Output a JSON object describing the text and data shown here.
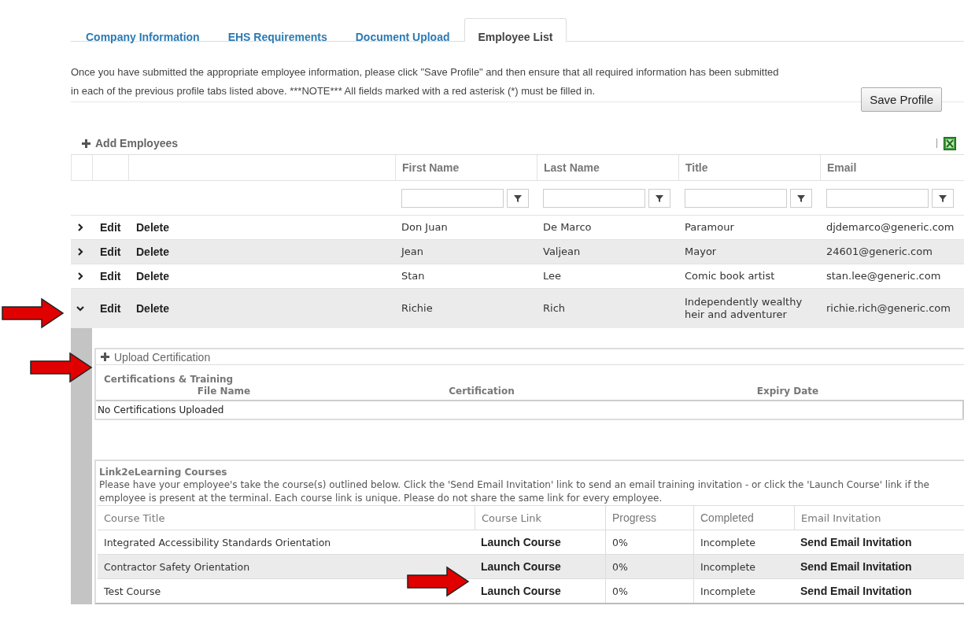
{
  "tabs": [
    {
      "label": "Company Information",
      "selected": false
    },
    {
      "label": "EHS Requirements",
      "selected": false
    },
    {
      "label": "Document Upload",
      "selected": false
    },
    {
      "label": "Employee List",
      "selected": true
    }
  ],
  "instructions": "Once you have submitted the appropriate employee information, please click \"Save Profile\" and then ensure that all required information has been submitted in each of the previous profile tabs listed above. ***NOTE*** All fields marked with a red asterisk (*) must be filled in.",
  "save_button": "Save Profile",
  "employee_table": {
    "add_label": "Add Employees",
    "columns": [
      "First Name",
      "Last Name",
      "Title",
      "Email"
    ],
    "rows": [
      {
        "expanded": false,
        "edit": "Edit",
        "delete": "Delete",
        "first_name": "Don Juan",
        "last_name": "De Marco",
        "title": "Paramour",
        "email": "djdemarco@generic.com"
      },
      {
        "expanded": false,
        "edit": "Edit",
        "delete": "Delete",
        "first_name": "Jean",
        "last_name": "Valjean",
        "title": "Mayor",
        "email": "24601@generic.com"
      },
      {
        "expanded": false,
        "edit": "Edit",
        "delete": "Delete",
        "first_name": "Stan",
        "last_name": "Lee",
        "title": "Comic book artist",
        "email": "stan.lee@generic.com"
      },
      {
        "expanded": true,
        "edit": "Edit",
        "delete": "Delete",
        "first_name": "Richie",
        "last_name": "Rich",
        "title": "Independently wealthy heir and adventurer",
        "email": "richie.rich@generic.com"
      }
    ]
  },
  "certifications": {
    "upload_label": "Upload Certification",
    "heading": "Certifications & Training",
    "columns": [
      "File Name",
      "Certification",
      "Expiry Date"
    ],
    "empty_message": "No Certifications Uploaded"
  },
  "courses": {
    "heading": "Link2eLearning Courses",
    "description": "Please have your employee's take the course(s) outlined below. Click the 'Send Email Invitation' link to send an email training invitation - or click the 'Launch Course' link if the employee is present at the terminal. Each course link is unique. Please do not share the same link for every employee.",
    "columns": [
      "Course Title",
      "Course Link",
      "Progress",
      "Completed",
      "Email Invitation"
    ],
    "rows": [
      {
        "title": "Integrated Accessibility Standards Orientation",
        "link": "Launch Course",
        "progress": "0%",
        "completed": "Incomplete",
        "invitation": "Send Email Invitation"
      },
      {
        "title": "Contractor Safety Orientation",
        "link": "Launch Course",
        "progress": "0%",
        "completed": "Incomplete",
        "invitation": "Send Email Invitation"
      },
      {
        "title": "Test Course",
        "link": "Launch Course",
        "progress": "0%",
        "completed": "Incomplete",
        "invitation": "Send Email Invitation"
      }
    ]
  }
}
